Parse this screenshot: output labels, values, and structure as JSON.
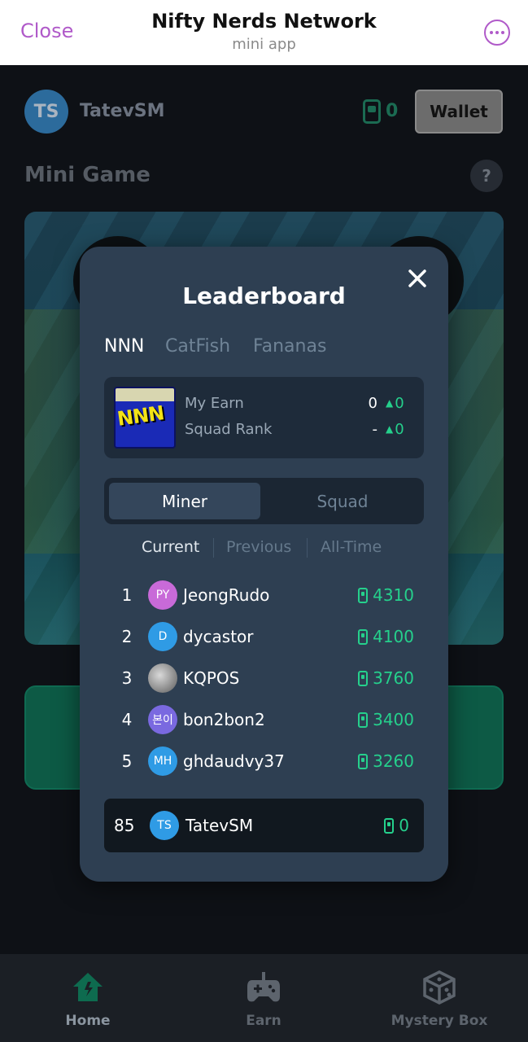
{
  "topbar": {
    "close_label": "Close",
    "title": "Nifty Nerds Network",
    "subtitle": "mini app"
  },
  "header": {
    "avatar_initials": "TS",
    "username": "TatevSM",
    "balance": "0",
    "wallet_label": "Wallet"
  },
  "section": {
    "title": "Mini Game",
    "help": "?"
  },
  "modal": {
    "title": "Leaderboard",
    "token_tabs": [
      "NNN",
      "CatFish",
      "Fananas"
    ],
    "logo_text": "NNN",
    "my_earn_label": "My Earn",
    "my_earn_value": "0",
    "my_earn_delta": "0",
    "squad_rank_label": "Squad Rank",
    "squad_rank_value": "-",
    "squad_rank_delta": "0",
    "segment": {
      "active": "Miner",
      "inactive": "Squad"
    },
    "periods": [
      "Current",
      "Previous",
      "All-Time"
    ],
    "rows": [
      {
        "rank": "1",
        "initials": "PY",
        "name": "JeongRudo",
        "amount": "4310",
        "color": "#c86ad8"
      },
      {
        "rank": "2",
        "initials": "D",
        "name": "dycastor",
        "amount": "4100",
        "color": "#2f9be5"
      },
      {
        "rank": "3",
        "initials": "",
        "name": "KQPOS",
        "amount": "3760",
        "color": "#8a8a8a"
      },
      {
        "rank": "4",
        "initials": "본이",
        "name": "bon2bon2",
        "amount": "3400",
        "color": "#7a69e0"
      },
      {
        "rank": "5",
        "initials": "MH",
        "name": "ghdaudvy37",
        "amount": "3260",
        "color": "#2f9be5"
      }
    ],
    "me": {
      "rank": "85",
      "initials": "TS",
      "name": "TatevSM",
      "amount": "0"
    }
  },
  "nav": {
    "home": "Home",
    "earn": "Earn",
    "mystery": "Mystery Box"
  },
  "colors": {
    "accent_green": "#25d08c",
    "close_purple": "#b05ac9",
    "modal_bg": "#2e3f52"
  }
}
